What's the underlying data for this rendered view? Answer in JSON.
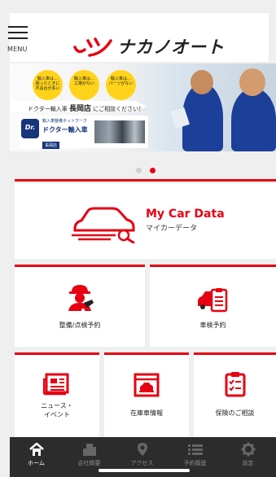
{
  "header": {
    "menu_label": "MENU",
    "brand_name": "ナカノオート"
  },
  "banner": {
    "bubbles": [
      {
        "l1": "輸入車は…",
        "l2": "困ったときに",
        "l3": "不具合が多い"
      },
      {
        "l1": "輸入車は…",
        "l2": "工場がない",
        "l3": ""
      },
      {
        "l1": "輸入車は…",
        "l2": "パーツがない",
        "l3": ""
      }
    ],
    "consult_pre": "ドクター輸入車",
    "consult_branch": "長岡店",
    "consult_post": "にご相談ください！",
    "dr_badge": "Dr.",
    "network": "輸入車整備ネットワーク",
    "brand": "ドクター輸入車",
    "branch": "長岡店"
  },
  "carousel": {
    "page_count": 2,
    "active_index": 1
  },
  "mycar": {
    "title": "My Car Data",
    "subtitle": "マイカーデータ"
  },
  "cards": {
    "maintenance": "整備/点検予約",
    "shaken": "車検予約",
    "news_line1": "ニュース・",
    "news_line2": "イベント",
    "stock": "在庫車情報",
    "insurance": "保険のご相談"
  },
  "tabbar": {
    "items": [
      {
        "label": "ホーム",
        "icon": "home-icon",
        "active": true
      },
      {
        "label": "会社概要",
        "icon": "building-icon",
        "active": false
      },
      {
        "label": "アクセス",
        "icon": "map-pin-icon",
        "active": false
      },
      {
        "label": "予約履歴",
        "icon": "list-icon",
        "active": false
      },
      {
        "label": "設定",
        "icon": "gear-icon",
        "active": false
      }
    ]
  },
  "colors": {
    "accent": "#e60012",
    "tabbar_bg": "#2c2c2c",
    "navy": "#16357a"
  }
}
